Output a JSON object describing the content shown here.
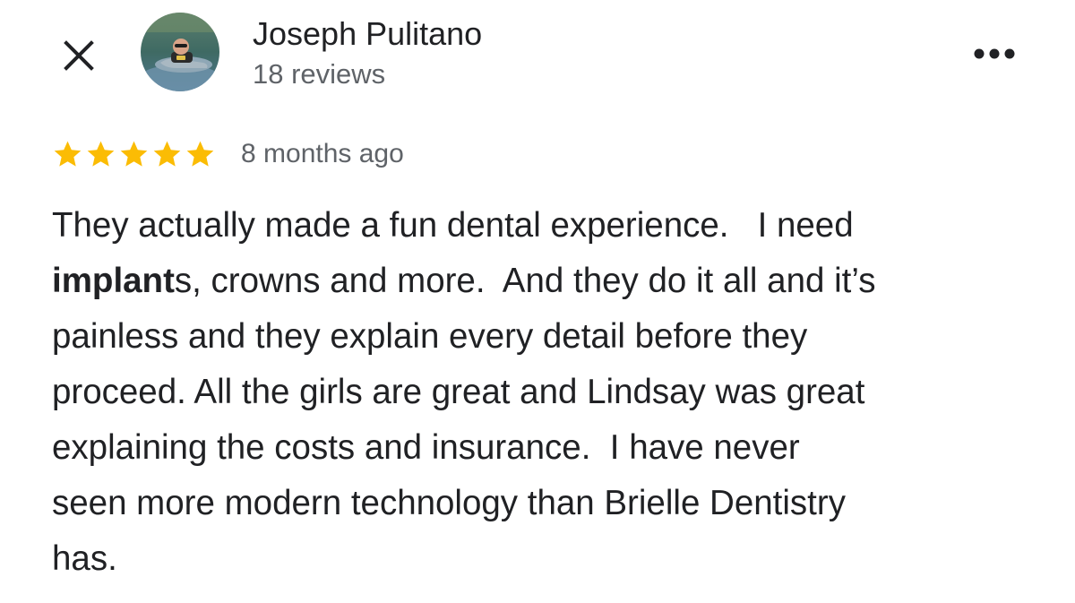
{
  "header": {
    "close_icon": "close-icon",
    "more_icon": "more-horizontal-icon",
    "reviewer": {
      "name": "Joseph Pulitano",
      "review_count": "18 reviews",
      "avatar": "reviewer-photo"
    }
  },
  "review": {
    "rating": 5,
    "max_rating": 5,
    "star_color": "#FBBC04",
    "time_ago": "8 months ago",
    "text_lines": [
      {
        "parts": [
          "They actually made a fun dental experience.   I need"
        ]
      },
      {
        "bold": "implant",
        "rest": "s, crowns and more.  And they do it all and it’s"
      },
      {
        "parts": [
          "painless and they explain every detail before they"
        ]
      },
      {
        "parts": [
          "proceed. All the girls are great and Lindsay was great"
        ]
      },
      {
        "parts": [
          "explaining the costs and insurance.  I have never"
        ]
      },
      {
        "parts": [
          "seen more modern technology than Brielle Dentistry"
        ]
      },
      {
        "parts": [
          "has."
        ]
      }
    ]
  }
}
